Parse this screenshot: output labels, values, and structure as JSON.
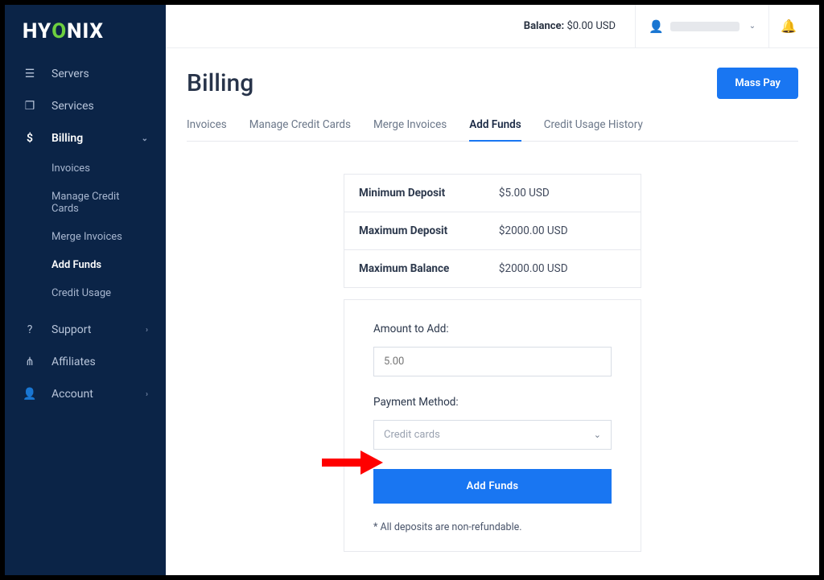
{
  "brand": "HYONIX",
  "sidebar": {
    "items": [
      {
        "label": "Servers",
        "icon": "servers"
      },
      {
        "label": "Services",
        "icon": "box"
      },
      {
        "label": "Billing",
        "icon": "dollar",
        "active": true,
        "expandable": true
      },
      {
        "label": "Support",
        "icon": "help",
        "expandable": true
      },
      {
        "label": "Affiliates",
        "icon": "share"
      },
      {
        "label": "Account",
        "icon": "user",
        "expandable": true
      }
    ],
    "billing_sub": [
      {
        "label": "Invoices"
      },
      {
        "label": "Manage Credit Cards"
      },
      {
        "label": "Merge Invoices"
      },
      {
        "label": "Add Funds",
        "active": true
      },
      {
        "label": "Credit Usage"
      }
    ]
  },
  "header": {
    "balance_label": "Balance:",
    "balance_value": "$0.00 USD"
  },
  "page": {
    "title": "Billing",
    "mass_pay": "Mass Pay"
  },
  "tabs": [
    {
      "label": "Invoices"
    },
    {
      "label": "Manage Credit Cards"
    },
    {
      "label": "Merge Invoices"
    },
    {
      "label": "Add Funds",
      "active": true
    },
    {
      "label": "Credit Usage History"
    }
  ],
  "limits": [
    {
      "label": "Minimum Deposit",
      "value": "$5.00 USD"
    },
    {
      "label": "Maximum Deposit",
      "value": "$2000.00 USD"
    },
    {
      "label": "Maximum Balance",
      "value": "$2000.00 USD"
    }
  ],
  "form": {
    "amount_label": "Amount to Add:",
    "amount_placeholder": "5.00",
    "method_label": "Payment Method:",
    "method_value": "Credit cards",
    "submit": "Add Funds",
    "note": "* All deposits are non-refundable."
  }
}
